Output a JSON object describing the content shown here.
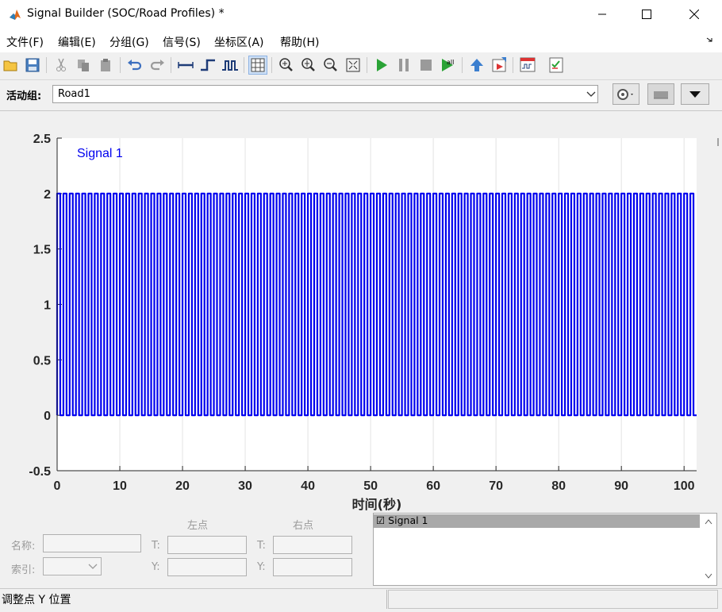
{
  "window": {
    "title": "Signal Builder (SOC/Road Profiles) *",
    "minimize_icon": "minimize-icon",
    "maximize_icon": "maximize-icon",
    "close_icon": "close-icon"
  },
  "menu": {
    "items": [
      "文件(F)",
      "编辑(E)",
      "分组(G)",
      "信号(S)",
      "坐标区(A)",
      "帮助(H)"
    ]
  },
  "toolbar": {
    "icons": [
      "open-icon",
      "save-icon",
      "cut-icon",
      "copy-icon",
      "paste-icon",
      "undo-icon",
      "redo-icon",
      "constant-icon",
      "step-icon",
      "pulse-icon",
      "grid-toggle-icon",
      "zoom-x-icon",
      "zoom-y-icon",
      "zoom-out-icon",
      "fit-icon",
      "play-icon",
      "pause-icon",
      "stop-icon",
      "run-all-icon",
      "up-arrow-icon",
      "export-icon",
      "scope-icon",
      "verify-icon"
    ]
  },
  "group": {
    "label": "活动组:",
    "value": "Road1"
  },
  "chart_data": {
    "type": "line",
    "legend_text": "Signal 1",
    "series": [
      {
        "name": "Signal 1",
        "color": "#0000ee",
        "pattern": "square wave",
        "low": 0,
        "high": 2,
        "x_start": 0,
        "x_end": 102,
        "period": 1
      }
    ],
    "xlabel": "时间(秒)",
    "ylabel": "",
    "xlim": [
      0,
      102
    ],
    "ylim": [
      -0.5,
      2.5
    ],
    "xticks": [
      0,
      10,
      20,
      30,
      40,
      50,
      60,
      70,
      80,
      90,
      100
    ],
    "yticks": [
      -0.5,
      0,
      0.5,
      1,
      1.5,
      2,
      2.5
    ],
    "ytick_labels": [
      "-0.5",
      "0",
      "0.5",
      "1",
      "1.5",
      "2",
      "2.5"
    ],
    "grid": "vertical"
  },
  "points": {
    "name_label": "名称:",
    "index_label": "索引:",
    "left_header": "左点",
    "right_header": "右点",
    "t_label": "T:",
    "y_label": "Y:"
  },
  "signal_list": {
    "items": [
      "☑ Signal 1"
    ]
  },
  "status": {
    "text": "调整点 Y 位置"
  }
}
